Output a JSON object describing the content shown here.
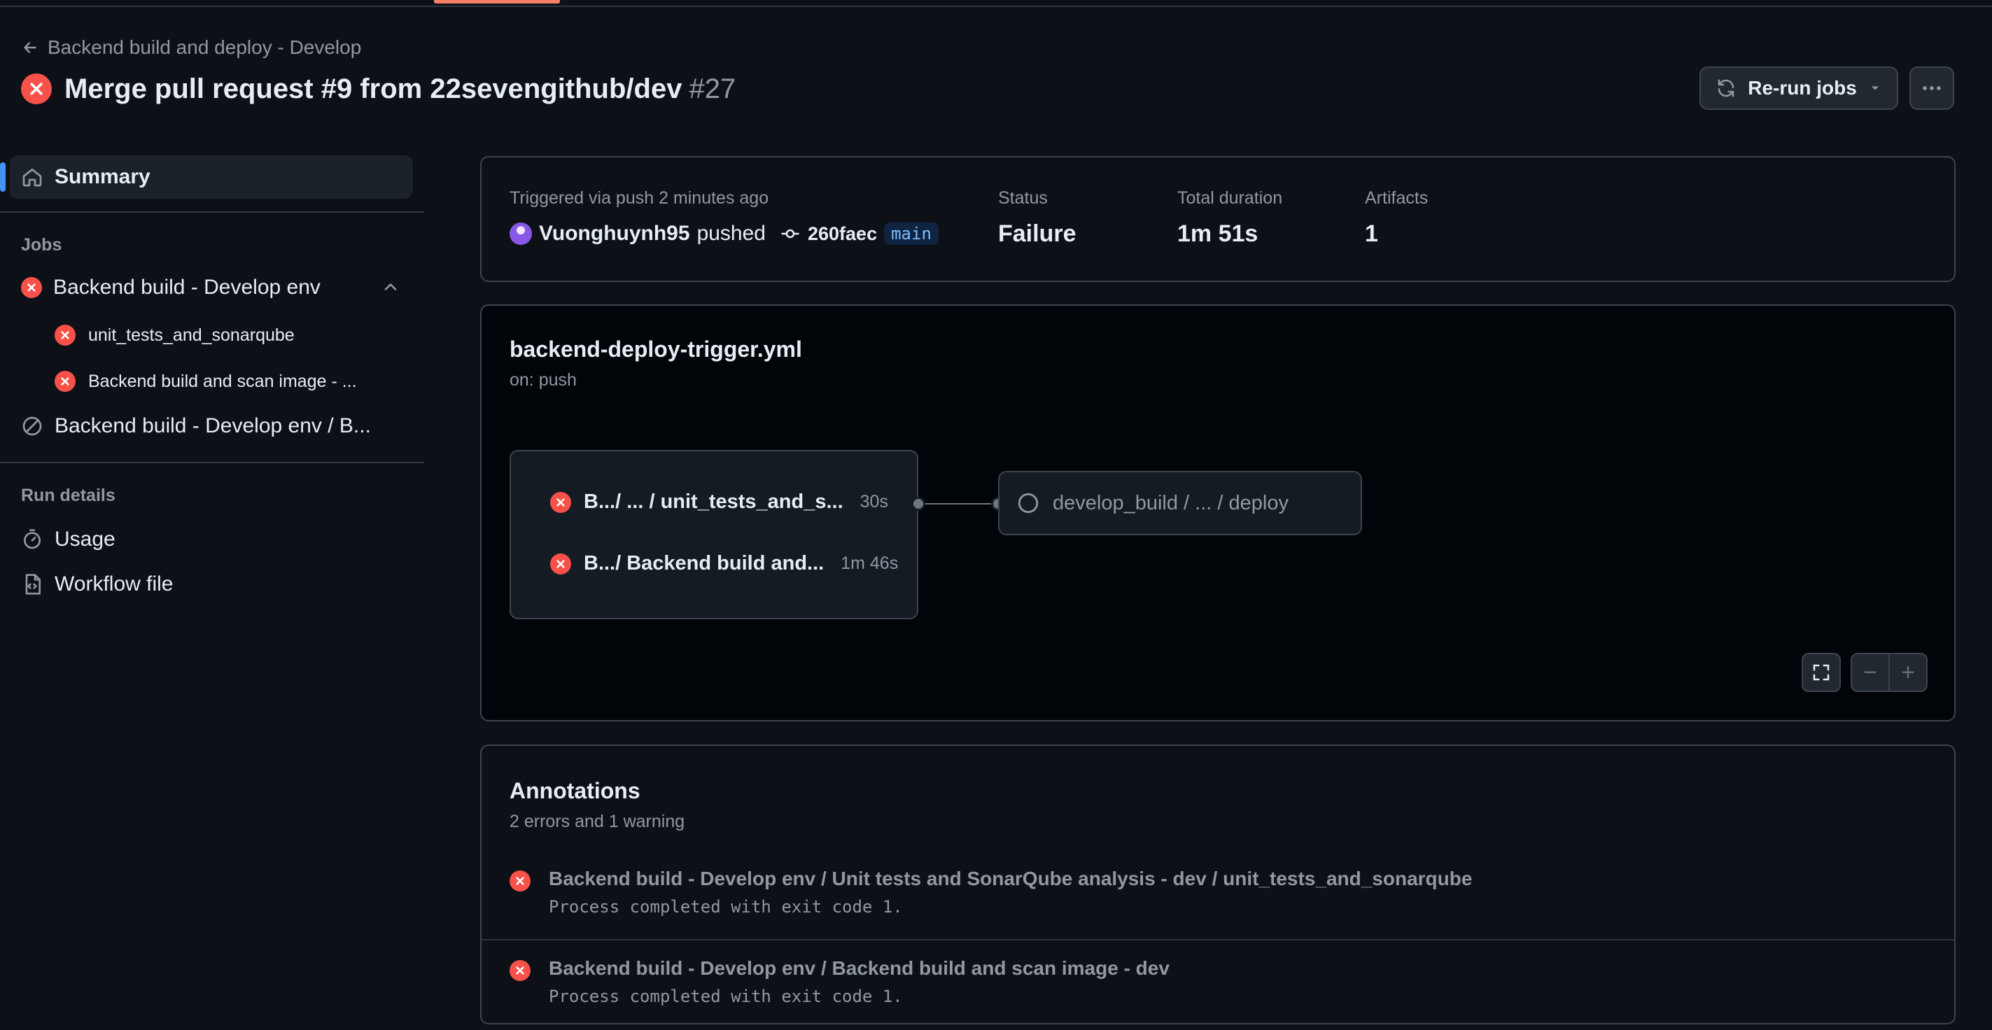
{
  "breadcrumb": {
    "label": "Backend build and deploy - Develop"
  },
  "header": {
    "title": "Merge pull request #9 from 22sevengithub/dev",
    "run_number": "#27"
  },
  "actions": {
    "rerun_label": "Re-run jobs"
  },
  "sidebar": {
    "summary_label": "Summary",
    "jobs_heading": "Jobs",
    "jobs": [
      {
        "label": "Backend build - Develop env",
        "status": "failure"
      },
      {
        "label": "unit_tests_and_sonarqube",
        "status": "failure"
      },
      {
        "label": "Backend build and scan image - ...",
        "status": "failure"
      },
      {
        "label": "Backend build - Develop env / B...",
        "status": "skipped"
      }
    ],
    "run_details_heading": "Run details",
    "usage_label": "Usage",
    "workflow_file_label": "Workflow file"
  },
  "summary": {
    "trigger_label": "Triggered via push 2 minutes ago",
    "actor": "Vuonghuynh95",
    "action": "pushed",
    "commit_sha": "260faec",
    "branch": "main",
    "status_label": "Status",
    "status_value": "Failure",
    "duration_label": "Total duration",
    "duration_value": "1m 51s",
    "artifacts_label": "Artifacts",
    "artifacts_value": "1"
  },
  "graph": {
    "filename": "backend-deploy-trigger.yml",
    "trigger": "on: push",
    "jobs": [
      {
        "label": "B.../ ... / unit_tests_and_s...",
        "duration": "30s",
        "status": "failure"
      },
      {
        "label": "B.../ Backend build and...",
        "duration": "1m 46s",
        "status": "failure"
      }
    ],
    "deploy_job": {
      "label": "develop_build / ... / deploy",
      "status": "pending"
    }
  },
  "annotations": {
    "title": "Annotations",
    "summary": "2 errors and 1 warning",
    "items": [
      {
        "title": "Backend build - Develop env / Unit tests and SonarQube analysis - dev / unit_tests_and_sonarqube",
        "message": "Process completed with exit code 1.",
        "severity": "error"
      },
      {
        "title": "Backend build - Develop env / Backend build and scan image - dev",
        "message": "Process completed with exit code 1.",
        "severity": "error"
      }
    ]
  },
  "colors": {
    "background": "#0d1117",
    "failure": "#f85149",
    "accent": "#4493f8",
    "active_tab": "#f78166"
  }
}
